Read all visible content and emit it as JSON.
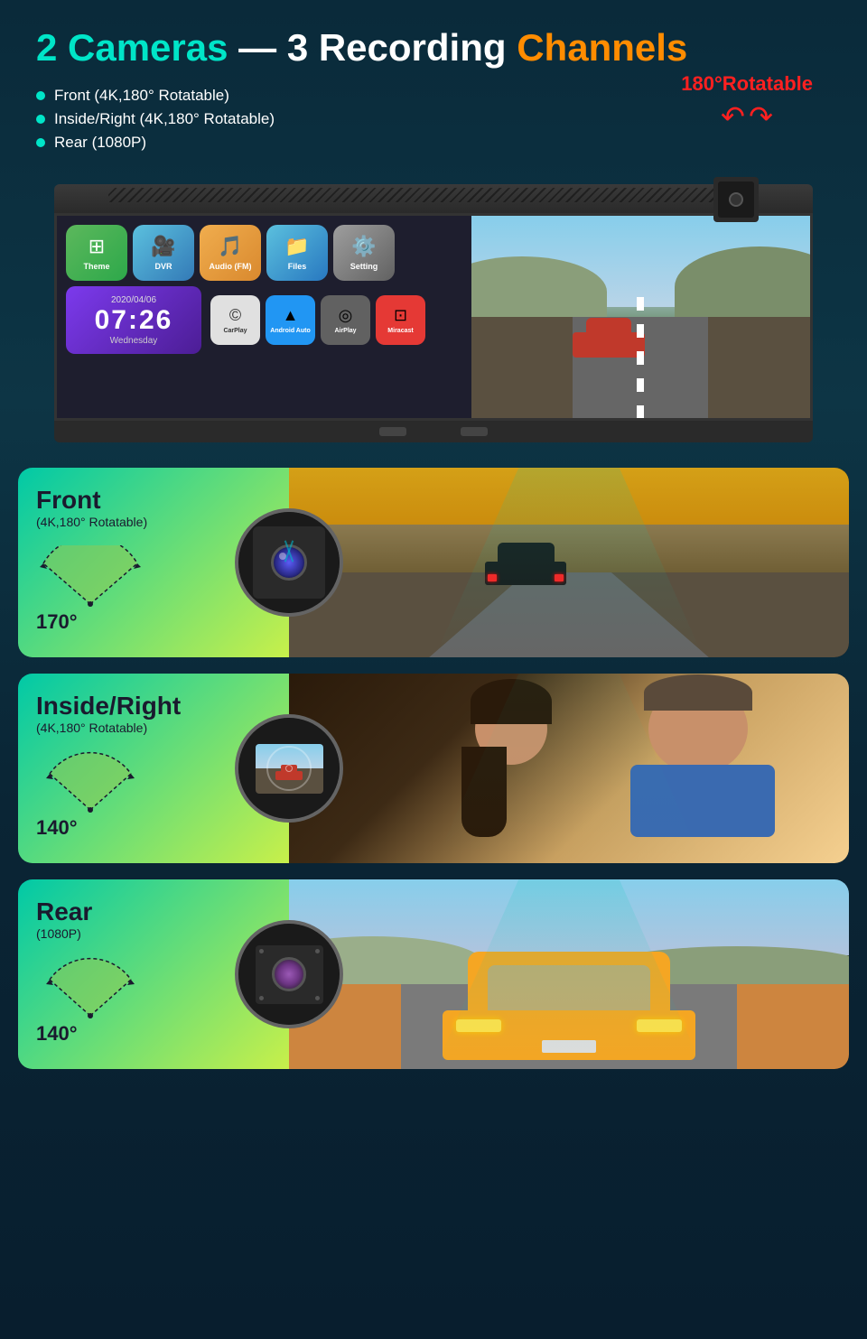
{
  "header": {
    "title_part1": "2 Cameras",
    "title_dash": " — ",
    "title_part2": "3 Recording",
    "title_part3": "Channels"
  },
  "features": [
    {
      "label": "Front  (4K,180° Rotatable)"
    },
    {
      "label": "Inside/Right  (4K,180° Rotatable)"
    },
    {
      "label": "Rear  (1080P)"
    }
  ],
  "rotatable_badge": {
    "text": "180°Rotatable"
  },
  "device": {
    "clock": {
      "date": "2020/04/06",
      "time": "07:26",
      "day": "Wednesday"
    },
    "apps": [
      {
        "label": "Theme",
        "symbol": "⊞"
      },
      {
        "label": "DVR",
        "symbol": "📹"
      },
      {
        "label": "Audio (FM)",
        "symbol": "📻"
      },
      {
        "label": "Files",
        "symbol": "📁"
      },
      {
        "label": "Setting",
        "symbol": "⚙"
      }
    ],
    "carplay": [
      {
        "label": "CarPlay",
        "symbol": "©"
      },
      {
        "label": "Android Auto",
        "symbol": "▲"
      },
      {
        "label": "AirPlay",
        "symbol": "◎"
      },
      {
        "label": "Miracast",
        "symbol": "⊡"
      }
    ]
  },
  "cameras": [
    {
      "id": "front",
      "title": "Front",
      "subtitle": "(4K,180° Rotatable)",
      "angle": "170°",
      "fov_color": "#b8d480"
    },
    {
      "id": "inside",
      "title": "Inside/Right",
      "subtitle": "(4K,180° Rotatable)",
      "angle": "140°",
      "fov_color": "#b8d480"
    },
    {
      "id": "rear",
      "title": "Rear",
      "subtitle": "(1080P)",
      "angle": "140°",
      "fov_color": "#b8d480"
    }
  ]
}
